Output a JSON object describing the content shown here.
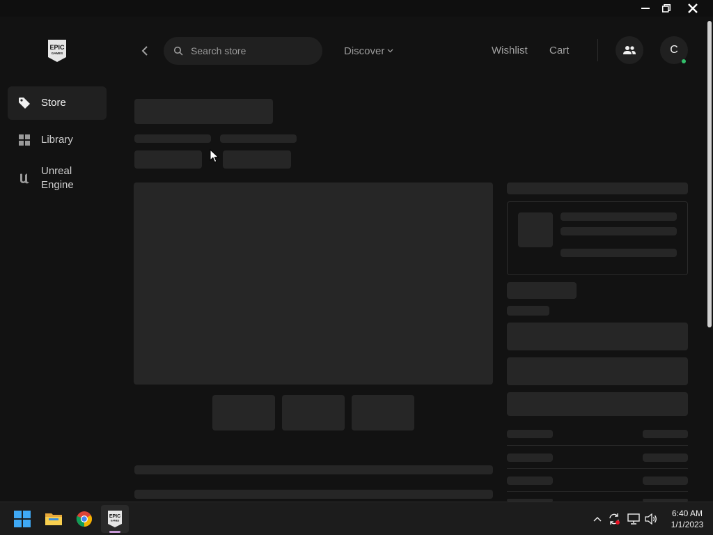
{
  "window": {
    "minimize_icon": "minimize-icon",
    "maximize_icon": "restore-icon",
    "close_icon": "close-icon"
  },
  "sidebar": {
    "logo_top": "EPIC",
    "logo_bottom": "GAMES",
    "items": [
      {
        "label": "Store",
        "icon": "tag-icon",
        "active": true
      },
      {
        "label": "Library",
        "icon": "grid-icon",
        "active": false
      },
      {
        "label": "Unreal\nEngine",
        "icon": "unreal-icon",
        "active": false
      }
    ]
  },
  "header": {
    "search": {
      "placeholder": "Search store",
      "value": ""
    },
    "discover_label": "Discover",
    "wishlist_label": "Wishlist",
    "cart_label": "Cart",
    "avatar_initial": "C",
    "status_color": "#32c06b"
  },
  "taskbar": {
    "apps": [
      "start-icon",
      "file-explorer-icon",
      "chrome-icon",
      "epic-games-icon"
    ],
    "epic_logo_top": "EPIC",
    "epic_logo_bottom": "GAMES",
    "time": "6:40 AM",
    "date": "1/1/2023"
  },
  "colors": {
    "background": "#121212",
    "skeleton": "#262626",
    "active_nav": "#202020"
  }
}
